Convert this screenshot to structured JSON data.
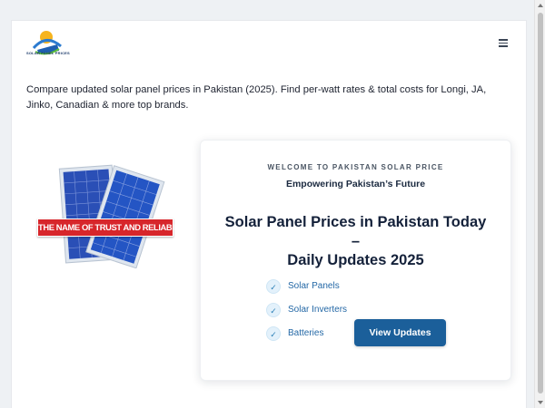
{
  "header": {
    "logo_text": "SOLAR PANEL PRICES",
    "menu_icon": "hamburger-menu-icon"
  },
  "intro": {
    "text": "Compare updated solar panel prices in Pakistan (2025). Find per-watt rates & total costs for Longi, JA, Jinko, Canadian & more top brands."
  },
  "hero_image": {
    "banner_text": "THE NAME OF TRUST AND RELIABILITY"
  },
  "hero_card": {
    "eyebrow": "WELCOME TO PAKISTAN SOLAR PRICE",
    "tagline": "Empowering Pakistan’s Future",
    "headline_line1": "Solar Panel Prices in Pakistan Today",
    "headline_line2": "–",
    "headline_line3": "Daily Updates 2025",
    "features": [
      {
        "label": "Solar Panels",
        "icon": "check-icon"
      },
      {
        "label": "Solar Inverters",
        "icon": "check-icon"
      },
      {
        "label": "Batteries",
        "icon": "check-icon"
      }
    ],
    "cta_label": "View Updates"
  },
  "colors": {
    "accent": "#1b5f9a",
    "banner_red": "#d7262b",
    "link_blue": "#2468a6"
  }
}
